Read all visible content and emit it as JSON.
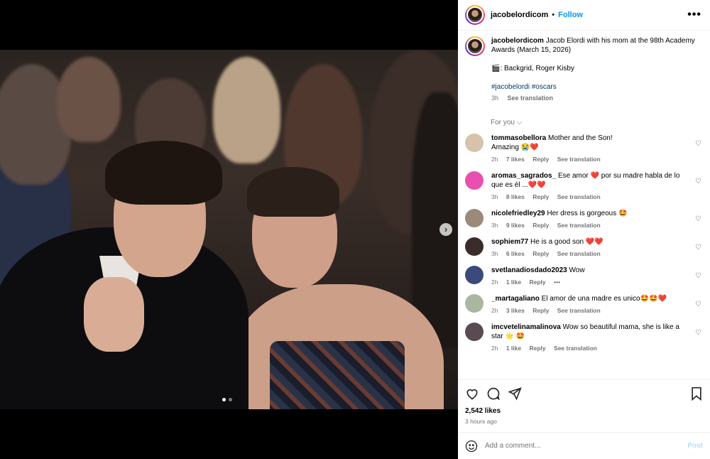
{
  "header": {
    "username": "jacobelordicom",
    "separator": "•",
    "follow_label": "Follow",
    "more_label": "•••"
  },
  "caption": {
    "username": "jacobelordicom",
    "text": "Jacob Elordi with his mom at the 98th Academy Awards (March 15, 2026)",
    "credit": "🎬: Backgrid, Roger Kisby",
    "hashtags": "#jacobelordi #oscars",
    "time": "3h",
    "see_translation": "See translation"
  },
  "for_you_label": "For you ⌵",
  "comments": [
    {
      "user": "tommasobellora",
      "text": "Mother and the Son!\nAmazing 😭❤️",
      "time": "2h",
      "likes": "7 likes",
      "reply": "Reply",
      "translate": "See translation",
      "avatar_color": "#d6c3a9"
    },
    {
      "user": "aromas_sagrados_",
      "text": "Ese amor ❤️ por su madre habla de lo que es él ...❤️❤️",
      "time": "3h",
      "likes": "8 likes",
      "reply": "Reply",
      "translate": "See translation",
      "avatar_color": "#e84fb0"
    },
    {
      "user": "nicolefriedley29",
      "text": "Her dress is gorgeous 🤩",
      "time": "3h",
      "likes": "9 likes",
      "reply": "Reply",
      "translate": "See translation",
      "avatar_color": "#9b8a7a"
    },
    {
      "user": "sophiem77",
      "text": "He is a good son ❤️❤️",
      "time": "3h",
      "likes": "6 likes",
      "reply": "Reply",
      "translate": "See translation",
      "avatar_color": "#3a2c28"
    },
    {
      "user": "svetlanadiosdado2023",
      "text": "Wow",
      "time": "2h",
      "likes": "1 like",
      "reply": "Reply",
      "translate": "•••",
      "avatar_color": "#3b4a7a"
    },
    {
      "user": "_martagaliano",
      "text": "El amor de una madre es unico🤩🤩❤️",
      "time": "2h",
      "likes": "3 likes",
      "reply": "Reply",
      "translate": "See translation",
      "avatar_color": "#a9b7a0"
    },
    {
      "user": "imcvetelinamalinova",
      "text": "Wow so beautiful mama, she is like a star 🌟 🤩",
      "time": "2h",
      "likes": "1 like",
      "reply": "Reply",
      "translate": "See translation",
      "avatar_color": "#5a4a52"
    }
  ],
  "actions": {
    "likes": "2,542 likes",
    "ago": "3 hours ago"
  },
  "add_comment": {
    "placeholder": "Add a comment...",
    "post_label": "Post"
  },
  "carousel": {
    "current": 1,
    "total": 2
  },
  "colors": {
    "link_blue": "#0095f6",
    "muted": "#737373",
    "post_disabled": "#b2dffc"
  }
}
